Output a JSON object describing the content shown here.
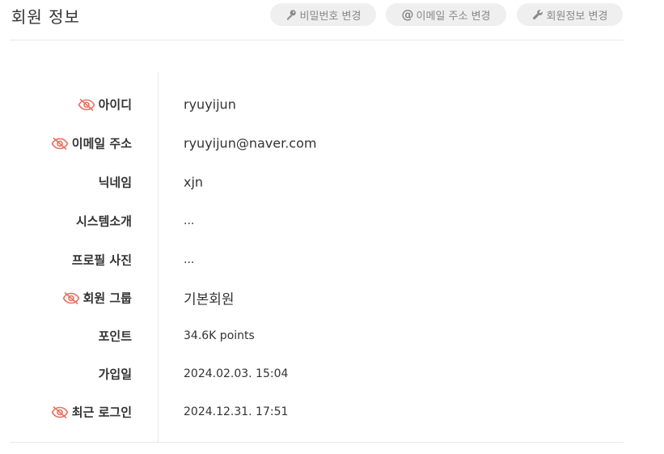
{
  "header": {
    "title": "회원 정보",
    "buttons": {
      "password": "비밀번호 변경",
      "email": "이메일 주소 변경",
      "info": "회원정보 변경"
    }
  },
  "fields": [
    {
      "label": "아이디",
      "value": "ryuyijun",
      "private": true
    },
    {
      "label": "이메일 주소",
      "value": "ryuyijun@naver.com",
      "private": true
    },
    {
      "label": "닉네임",
      "value": "xjn",
      "private": false
    },
    {
      "label": "시스템소개",
      "value": "...",
      "private": false
    },
    {
      "label": "프로필 사진",
      "value": "...",
      "private": false
    },
    {
      "label": "회원 그룹",
      "value": "기본회원",
      "private": true
    },
    {
      "label": "포인트",
      "value": "34.6K points",
      "private": false
    },
    {
      "label": "가입일",
      "value": "2024.02.03. 15:04",
      "private": false
    },
    {
      "label": "최근 로그인",
      "value": "2024.12.31. 17:51",
      "private": true
    }
  ],
  "colors": {
    "private_icon": "#e8705f",
    "button_bg": "#efefef",
    "button_text": "#888888"
  }
}
